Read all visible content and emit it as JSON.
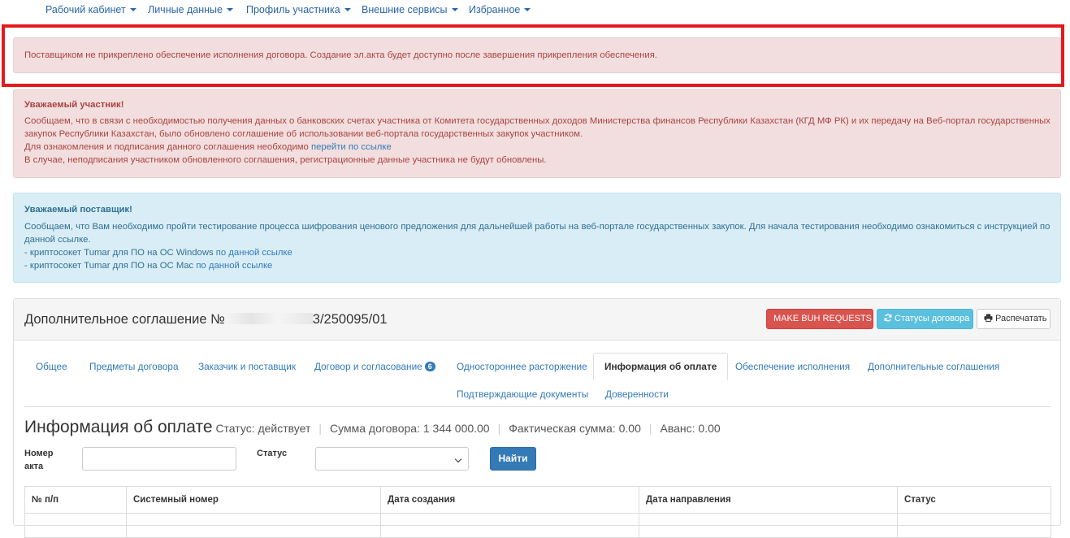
{
  "nav": {
    "items": [
      {
        "label": "Рабочий кабинет"
      },
      {
        "label": "Личные данные"
      },
      {
        "label": "Профиль участника"
      },
      {
        "label": "Внешние сервисы"
      },
      {
        "label": "Избранное"
      }
    ]
  },
  "alerts": {
    "security": {
      "text": "Поставщиком не прикреплено обеспечение исполнения договора. Создание эл.акта будет доступно после завершения прикрепления обеспечения."
    },
    "participant": {
      "title": "Уважаемый участник!",
      "line1": "Сообщаем, что в связи с необходимостью получения данных о банковских счетах участника от Комитета государственных доходов Министерства финансов Республики Казахстан (КГД МФ РК) и их передачу на Веб-портал государственных",
      "line2": "закупок Республики Казахстан, было обновлено соглашение об использовании веб-портала государственных закупок участником.",
      "line3_text": "Для ознакомления и подписания данного соглашения необходимо",
      "line3_link": "перейти по ссылке",
      "line4": "В случае, неподписания участником обновленного соглашения, регистрационные данные участника не будут обновлены."
    },
    "supplier": {
      "title": "Уважаемый поставщик!",
      "line1": "Сообщаем, что Вам необходимо пройти тестирование процесса шифрования ценового предложения для дальнейшей работы на веб-портале государственных закупок. Для начала тестирования необходимо ознакомиться с инструкцией по",
      "line2": "данной ссылке.",
      "win_text": "- криптосокет Tumar для ПО на ОС Windows",
      "win_link": "по данной ссылке",
      "mac_text": "- криптосокет Tumar для ПО на ОС Mac",
      "mac_link": "по данной ссылке"
    }
  },
  "panel": {
    "title_prefix": "Дополнительное соглашение №",
    "title_suffix": "3/250095/01",
    "btn_make_buh": "MAKE BUH REQUESTS",
    "btn_statuses": "Статусы договора",
    "btn_print": "Распечатать"
  },
  "tabs": [
    {
      "label": "Общее"
    },
    {
      "label": "Предметы договора"
    },
    {
      "label": "Заказчик и поставщик"
    },
    {
      "label": "Договор и согласование",
      "badge": "6"
    },
    {
      "label": "Одностороннее расторжение"
    },
    {
      "label": "Информация об оплате"
    },
    {
      "label": "Обеспечение исполнения"
    },
    {
      "label": "Дополнительные соглашения"
    },
    {
      "label": "Подтверждающие документы"
    },
    {
      "label": "Доверенности"
    }
  ],
  "payment": {
    "heading": "Информация об оплате",
    "status": "Статус: действует",
    "contract_sum": "Сумма договора: 1 344 000.00",
    "actual_sum": "Фактическая сумма: 0.00",
    "advance": "Аванс: 0.00"
  },
  "filters": {
    "act_number_label_1": "Номер",
    "act_number_label_2": "акта",
    "act_number_value": "",
    "status_label": "Статус",
    "status_value": "",
    "find_button": "Найти"
  },
  "table": {
    "columns": [
      "№ п/п",
      "Системный номер",
      "Дата создания",
      "Дата направления",
      "Статус"
    ]
  },
  "colors": {
    "accent": "#337ab7",
    "danger": "#d9534f",
    "info": "#5bc0de",
    "highlight": "#e31b1b"
  }
}
